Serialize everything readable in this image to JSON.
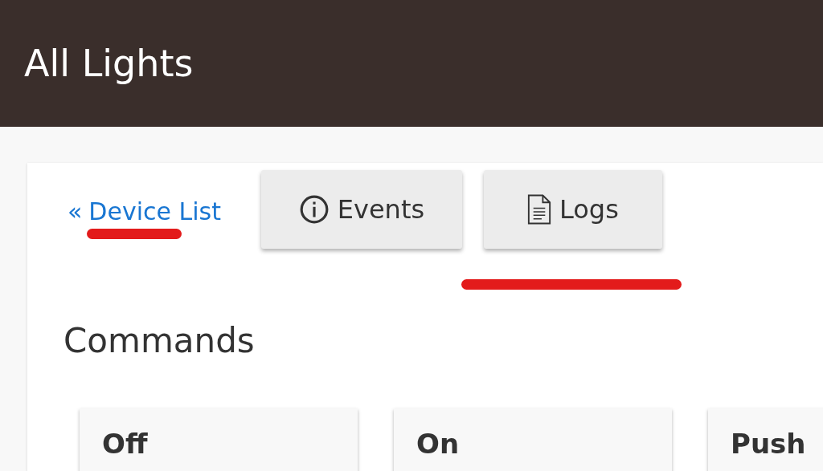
{
  "header": {
    "title": "All Lights"
  },
  "back_link": {
    "arrow": "«",
    "label": "Device List",
    "underlined": true
  },
  "buttons": [
    {
      "label": "Events",
      "kind": "info",
      "underlined": false
    },
    {
      "label": "Logs",
      "kind": "document",
      "underlined": true
    }
  ],
  "section_title": "Commands",
  "commands": [
    {
      "label": "Off"
    },
    {
      "label": "On"
    },
    {
      "label": "Push"
    }
  ]
}
